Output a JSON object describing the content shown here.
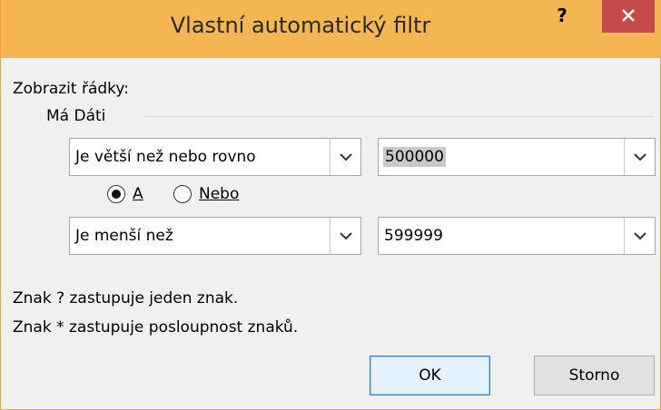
{
  "window": {
    "title": "Vlastní automatický filtr",
    "help_label": "?",
    "close_label": "×"
  },
  "section_label": "Zobrazit řádky:",
  "field_name": "Má Dáti",
  "condition1": {
    "operator": "Je větší než nebo rovno",
    "value": "500000"
  },
  "logic": {
    "and_label": "A",
    "or_label": "Nebo",
    "selected": "A"
  },
  "condition2": {
    "operator": "Je menší než",
    "value": "599999"
  },
  "hints": {
    "line1": "Znak ? zastupuje jeden znak.",
    "line2": "Znak * zastupuje posloupnost znaků."
  },
  "buttons": {
    "ok_label": "OK",
    "cancel_label": "Storno"
  },
  "colors": {
    "titlebar": "#f4b552",
    "close_button": "#c74a4a",
    "dialog_bg": "#f0f0f0"
  }
}
